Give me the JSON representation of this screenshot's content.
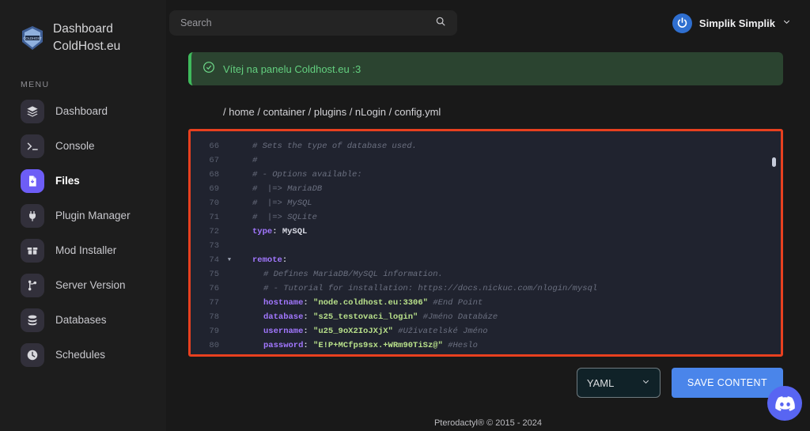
{
  "sidebar": {
    "brand": {
      "line1": "Dashboard",
      "line2": "ColdHost.eu",
      "logo_alt": "coldhost-logo"
    },
    "menu_label": "MENU",
    "items": [
      {
        "label": "Dashboard",
        "icon": "layers-icon",
        "active": false
      },
      {
        "label": "Console",
        "icon": "terminal-icon",
        "active": false
      },
      {
        "label": "Files",
        "icon": "file-icon",
        "active": true
      },
      {
        "label": "Plugin Manager",
        "icon": "plug-icon",
        "active": false
      },
      {
        "label": "Mod Installer",
        "icon": "box-icon",
        "active": false
      },
      {
        "label": "Server Version",
        "icon": "git-branch-icon",
        "active": false
      },
      {
        "label": "Databases",
        "icon": "database-icon",
        "active": false
      },
      {
        "label": "Schedules",
        "icon": "clock-icon",
        "active": false
      }
    ]
  },
  "topbar": {
    "search": {
      "placeholder": "Search",
      "value": "",
      "icon": "search-icon"
    },
    "user": {
      "name": "Simplik Simplik",
      "avatar_alt": "user-avatar",
      "chevron": "chevron-down-icon"
    }
  },
  "alert": {
    "icon": "check-circle-icon",
    "text": "Vítej na panelu Coldhost.eu :3",
    "accent_color": "#3fba5c",
    "background_color": "#2b4430"
  },
  "breadcrumb": {
    "path": "/ home / container / plugins / nLogin / config.yml"
  },
  "editor": {
    "border_color": "#e8401f",
    "background_color": "#20232f",
    "lines": [
      {
        "num": "66",
        "fold": "",
        "indent": 2,
        "tokens": [
          {
            "t": "cmt",
            "v": "# Sets the type of database used."
          }
        ]
      },
      {
        "num": "67",
        "fold": "",
        "indent": 2,
        "tokens": [
          {
            "t": "cmt",
            "v": "#"
          }
        ]
      },
      {
        "num": "68",
        "fold": "",
        "indent": 2,
        "tokens": [
          {
            "t": "cmt",
            "v": "# - Options available:"
          }
        ]
      },
      {
        "num": "69",
        "fold": "",
        "indent": 2,
        "tokens": [
          {
            "t": "cmt",
            "v": "#  |=> MariaDB"
          }
        ]
      },
      {
        "num": "70",
        "fold": "",
        "indent": 2,
        "tokens": [
          {
            "t": "cmt",
            "v": "#  |=> MySQL"
          }
        ]
      },
      {
        "num": "71",
        "fold": "",
        "indent": 2,
        "tokens": [
          {
            "t": "cmt",
            "v": "#  |=> SQLite"
          }
        ]
      },
      {
        "num": "72",
        "fold": "",
        "indent": 2,
        "tokens": [
          {
            "t": "key",
            "v": "type"
          },
          {
            "t": "plain",
            "v": ": MySQL"
          }
        ]
      },
      {
        "num": "73",
        "fold": "",
        "indent": 2,
        "tokens": [
          {
            "t": "plain",
            "v": ""
          }
        ]
      },
      {
        "num": "74",
        "fold": "▼",
        "indent": 2,
        "tokens": [
          {
            "t": "key",
            "v": "remote"
          },
          {
            "t": "plain",
            "v": ":"
          }
        ]
      },
      {
        "num": "75",
        "fold": "",
        "indent": 4,
        "tokens": [
          {
            "t": "cmt",
            "v": "# Defines MariaDB/MySQL information."
          }
        ]
      },
      {
        "num": "76",
        "fold": "",
        "indent": 4,
        "tokens": [
          {
            "t": "cmt",
            "v": "# - Tutorial for installation: https://docs.nickuc.com/nlogin/mysql"
          }
        ]
      },
      {
        "num": "77",
        "fold": "",
        "indent": 4,
        "tokens": [
          {
            "t": "key",
            "v": "hostname"
          },
          {
            "t": "plain",
            "v": ": "
          },
          {
            "t": "str",
            "v": "\"node.coldhost.eu:3306\""
          },
          {
            "t": "cmt",
            "v": " #End Point"
          }
        ]
      },
      {
        "num": "78",
        "fold": "",
        "indent": 4,
        "tokens": [
          {
            "t": "key",
            "v": "database"
          },
          {
            "t": "plain",
            "v": ": "
          },
          {
            "t": "str",
            "v": "\"s25_testovaci_login\""
          },
          {
            "t": "cmt",
            "v": " #Jméno Databáze"
          }
        ]
      },
      {
        "num": "79",
        "fold": "",
        "indent": 4,
        "tokens": [
          {
            "t": "key",
            "v": "username"
          },
          {
            "t": "plain",
            "v": ": "
          },
          {
            "t": "str",
            "v": "\"u25_9oX2IoJXjX\""
          },
          {
            "t": "cmt",
            "v": " #Uživatelské Jméno"
          }
        ]
      },
      {
        "num": "80",
        "fold": "",
        "indent": 4,
        "tokens": [
          {
            "t": "key",
            "v": "password"
          },
          {
            "t": "plain",
            "v": ": "
          },
          {
            "t": "str",
            "v": "\"E!P+MCfps9sx.+WRm90TiSz@\""
          },
          {
            "t": "cmt",
            "v": " #Heslo"
          }
        ]
      }
    ]
  },
  "bottombar": {
    "language": {
      "value": "YAML",
      "chevron": "chevron-down-icon"
    },
    "save_label": "SAVE CONTENT",
    "save_color": "#4a85ea"
  },
  "footer": {
    "text": "Pterodactyl® © 2015 - 2024"
  },
  "discord": {
    "icon": "discord-icon",
    "color": "#5865f2"
  }
}
